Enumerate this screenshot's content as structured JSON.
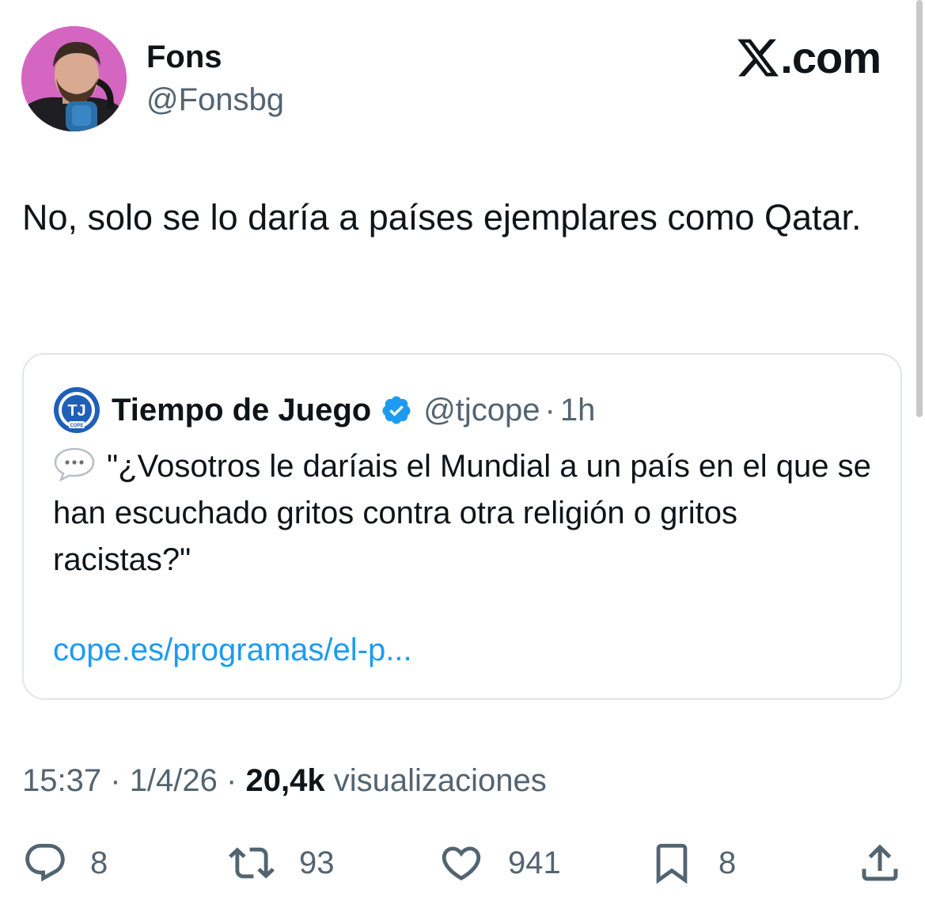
{
  "author": {
    "display_name": "Fons",
    "handle": "@Fonsbg"
  },
  "brand": {
    "label": ".com",
    "icon": "x-logo-icon"
  },
  "tweet": {
    "text": "No, solo se lo daría a países ejemplares como Qatar."
  },
  "quote": {
    "display_name": "Tiempo de Juego",
    "handle": "@tjcope",
    "separator": "·",
    "time": "1h",
    "text": "\"¿Vosotros le daríais el Mundial a un país en el que se han escuchado gritos contra otra religión o gritos racistas?\"",
    "link": "cope.es/programas/el-p...",
    "avatar_logo_text": "TJ",
    "avatar_logo_sub": "COPE"
  },
  "meta": {
    "time": "15:37",
    "separator": "·",
    "date": "1/4/26",
    "views_count": "20,4k",
    "views_label": "visualizaciones"
  },
  "actions": {
    "replies": "8",
    "reposts": "93",
    "likes": "941",
    "bookmarks": "8"
  },
  "colors": {
    "text": "#0f1419",
    "secondary": "#536471",
    "link": "#1d9bf0",
    "verified": "#1d9bf0",
    "border": "#e1e6ea"
  }
}
